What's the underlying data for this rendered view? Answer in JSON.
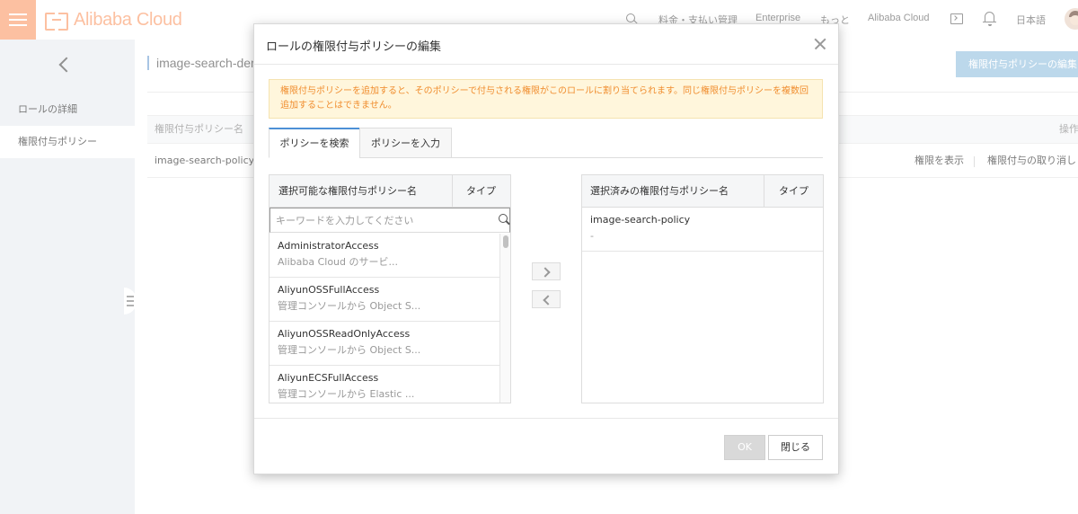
{
  "topbar": {
    "logo_text": "Alibaba Cloud",
    "nav": [
      "料金・支払い管理",
      "Enterprise",
      "もっと",
      "Alibaba Cloud",
      "日本語"
    ]
  },
  "sidebar": {
    "items": [
      {
        "label": "ロールの詳細"
      },
      {
        "label": "権限付与ポリシー"
      }
    ]
  },
  "background": {
    "page_title": "image-search-demo",
    "edit_button": "権限付与ポリシーの編集",
    "table": {
      "headers": [
        "権限付与ポリシー名",
        "操作"
      ],
      "rows": [
        {
          "name": "image-search-policy",
          "actions": [
            "権限を表示",
            "権限付与の取り消し"
          ]
        }
      ]
    }
  },
  "modal": {
    "title": "ロールの権限付与ポリシーの編集",
    "notice": "権限付与ポリシーを追加すると、そのポリシーで付与される権限がこのロールに割り当てられます。同じ権限付与ポリシーを複数回追加することはできません。",
    "tabs": [
      "ポリシーを検索",
      "ポリシーを入力"
    ],
    "available": {
      "header_name": "選択可能な権限付与ポリシー名",
      "header_type": "タイプ",
      "search_placeholder": "キーワードを入力してください",
      "items": [
        {
          "name": "AdministratorAccess",
          "desc": "Alibaba Cloud のサービ..."
        },
        {
          "name": "AliyunOSSFullAccess",
          "desc": "管理コンソールから Object S..."
        },
        {
          "name": "AliyunOSSReadOnlyAccess",
          "desc": "管理コンソールから Object S..."
        },
        {
          "name": "AliyunECSFullAccess",
          "desc": "管理コンソールから Elastic ..."
        }
      ]
    },
    "selected": {
      "header_name": "選択済みの権限付与ポリシー名",
      "header_type": "タイプ",
      "items": [
        {
          "name": "image-search-policy",
          "desc": "-"
        }
      ]
    },
    "buttons": {
      "ok": "OK",
      "close": "閉じる"
    }
  },
  "colors": {
    "brand": "#fb9f6f",
    "primary": "#4d90d6",
    "notice_text": "#f08d2e",
    "notice_bg": "#fff6dc",
    "link": "#6a9fd1"
  }
}
